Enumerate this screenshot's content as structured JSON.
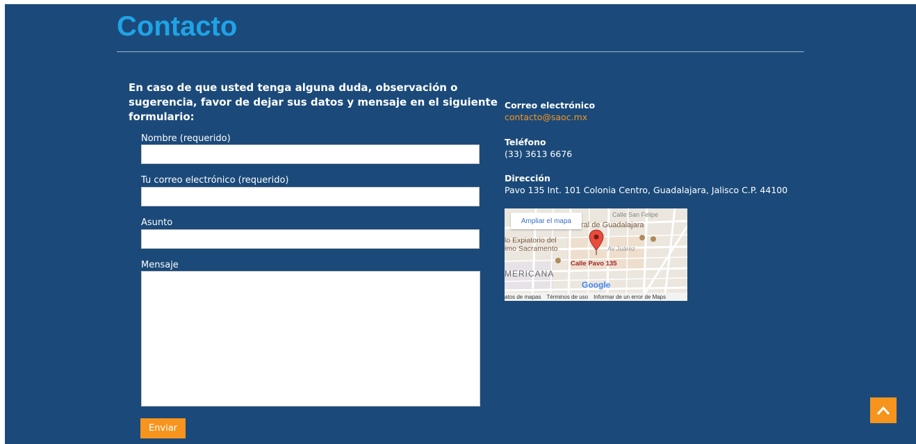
{
  "page": {
    "title": "Contacto",
    "intro": "En caso de que usted tenga alguna duda, observación o sugerencia, favor de dejar sus datos y mensaje en el siguiente formulario:"
  },
  "form": {
    "name_label": "Nombre (requerido)",
    "name_value": "",
    "email_label": "Tu correo electrónico (requerido)",
    "email_value": "",
    "subject_label": "Asunto",
    "subject_value": "",
    "message_label": "Mensaje",
    "message_value": "",
    "submit_label": "Enviar"
  },
  "contact": {
    "email_heading": "Correo electrónico",
    "email": "contacto@saoc.mx",
    "phone_heading": "Teléfono",
    "phone": "(33) 3613 6676",
    "address_heading": "Dirección",
    "address": "Pavo 135 Int. 101 Colonia Centro, Guadalajara, Jalisco C.P. 44100"
  },
  "map": {
    "expand_label": "Ampliar el mapa",
    "labels": {
      "street_top": "Calle San Felipe",
      "cathedral": "ral de Guadalajara",
      "temple_1": "lo Expiatorio del",
      "temple_2": "imo Sacramento",
      "avenue": "Av Juárez",
      "pin_label": "Calle Pavo 135",
      "neighborhood": "MERICANA",
      "google": "Google"
    },
    "footer": [
      "atos de mapas",
      "Términos de uso",
      "Informar de un error de Maps"
    ]
  },
  "colors": {
    "background": "#1b4a7a",
    "title": "#1fa3e6",
    "accent": "#f7941d"
  },
  "icons": {
    "back_to_top": "chevron-up-icon",
    "map_pin": "map-pin-icon"
  }
}
